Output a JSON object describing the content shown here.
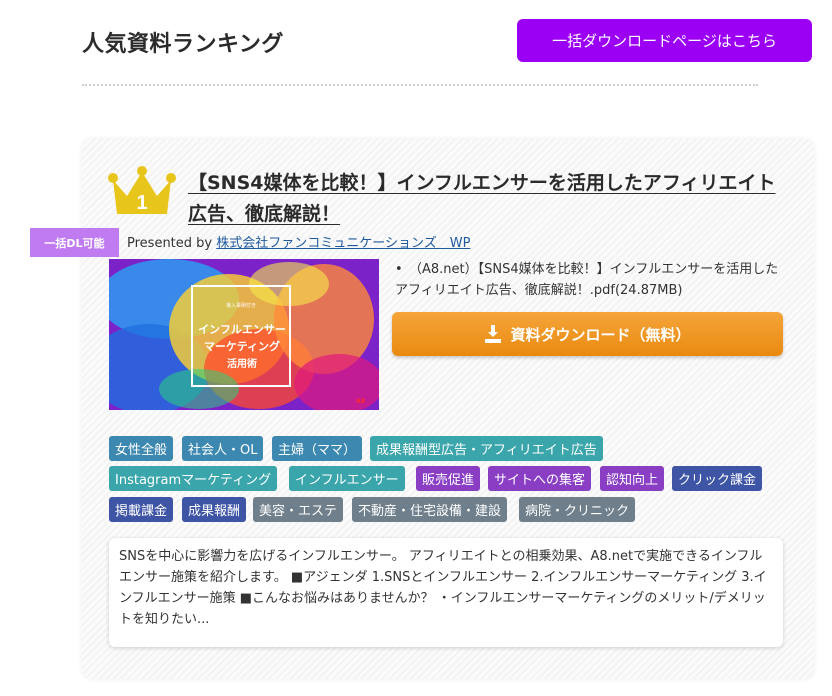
{
  "header": {
    "title": "人気資料ランキング",
    "bulk_download_label": "一括ダウンロードページはこちら"
  },
  "item": {
    "rank": "1",
    "title": "【SNS4媒体を比較！】インフルエンサーを活用したアフィリエイト広告、徹底解説！",
    "bulk_dl_badge": "一括DL可能",
    "presented_prefix": "Presented by",
    "company": "株式会社ファンコミュニケーションズ　WP",
    "file_info": "（A8.net）【SNS4媒体を比較！】インフルエンサーを活用したアフィリエイト広告、徹底解説！.pdf(24.87MB)",
    "download_label": "資料ダウンロード（無料）",
    "thumbnail": {
      "small_text": "導入事例付き",
      "line1": "インフルエンサー",
      "line2": "マーケティング",
      "line3": "活用術",
      "brand": "A8"
    },
    "tags": [
      "女性全般",
      "社会人・OL",
      "主婦（ママ）",
      "成果報酬型広告・アフィリエイト広告",
      "Instagramマーケティング",
      "インフルエンサー",
      "販売促進",
      "サイトへの集客",
      "認知向上",
      "クリック課金",
      "掲載課金",
      "成果報酬",
      "美容・エステ",
      "不動産・住宅設備・建設",
      "病院・クリニック"
    ],
    "description": "SNSを中心に影響力を広げるインフルエンサー。 アフィリエイトとの相乗効果、A8.netで実施できるインフルエンサー施策を紹介します。 ■アジェンダ 1.SNSとインフルエンサー 2.インフルエンサーマーケティング 3.インフルエンサー施策 ■こんなお悩みはありませんか？ ・インフルエンサーマーケティングのメリット/デメリットを知りたい..."
  },
  "colors": {
    "bulk_button": "#9b00f5",
    "download_button": "#f0961f",
    "crown": "#e8c51a",
    "badge": "#c07bf0"
  }
}
